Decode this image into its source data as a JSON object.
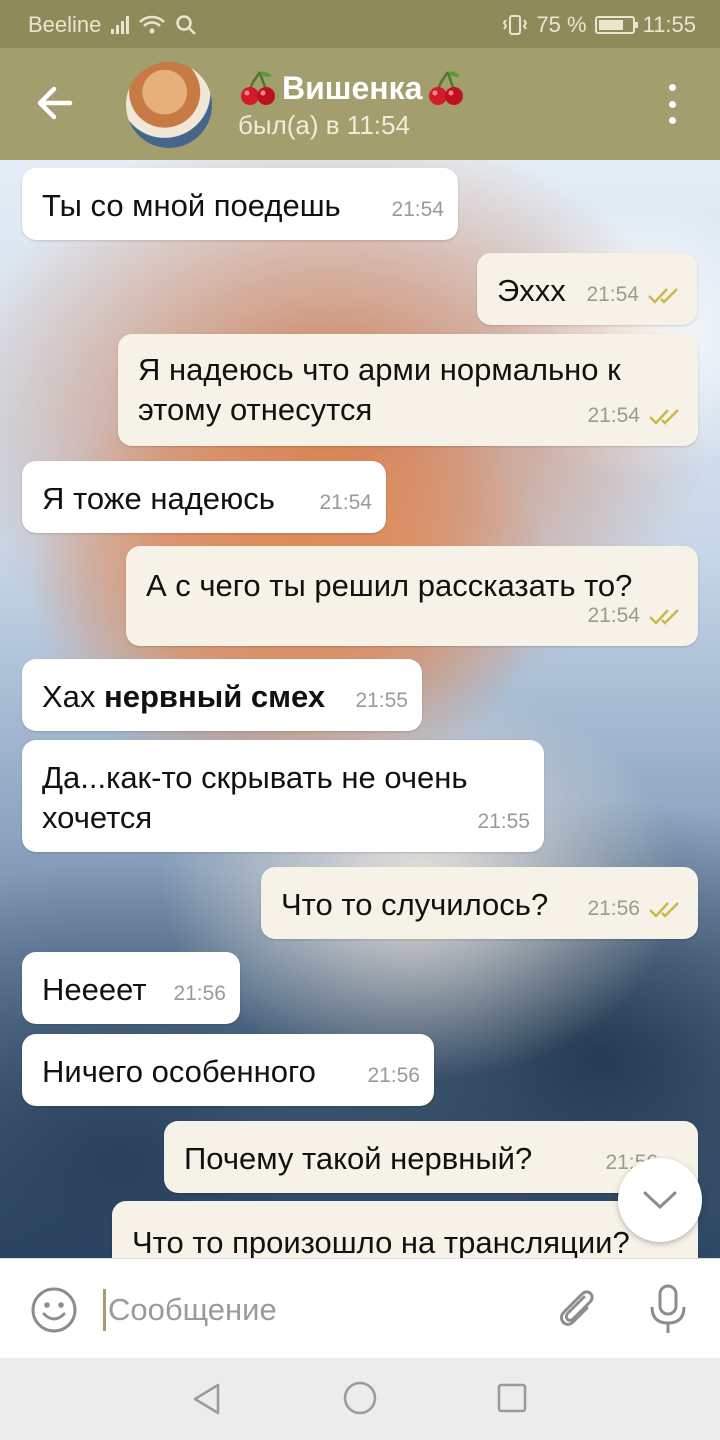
{
  "status_bar": {
    "carrier": "Beeline",
    "battery": "75 %",
    "battery_level": 0.75,
    "time": "11:55"
  },
  "header": {
    "contact_name": "Вишенка",
    "last_seen": "был(а) в 11:54"
  },
  "messages": [
    {
      "dir": "in",
      "text": "Ты со мной поедешь",
      "time": "21:54"
    },
    {
      "dir": "out",
      "text": "Эххх",
      "time": "21:54",
      "read": true
    },
    {
      "dir": "out",
      "text": "Я надеюсь что арми нормально к этому отнесутся",
      "time": "21:54",
      "read": true
    },
    {
      "dir": "in",
      "text": "Я тоже надеюсь",
      "time": "21:54"
    },
    {
      "dir": "out",
      "text": "А с чего ты решил рассказать то?",
      "time": "21:54",
      "read": true
    },
    {
      "dir": "in",
      "text_prefix": "Хах ",
      "text_bold": "нервный смех",
      "time": "21:55"
    },
    {
      "dir": "in",
      "text": "Да...как-то скрывать не очень хочется",
      "time": "21:55"
    },
    {
      "dir": "out",
      "text": "Что то случилось?",
      "time": "21:56",
      "read": true
    },
    {
      "dir": "in",
      "text": "Неееет",
      "time": "21:56"
    },
    {
      "dir": "in",
      "text": "Ничего особенного",
      "time": "21:56"
    },
    {
      "dir": "out",
      "text": "Почему такой нервный?",
      "time": "21:56"
    },
    {
      "dir": "out",
      "text": "Что то произошло на трансляции?"
    }
  ],
  "input": {
    "placeholder": "Сообщение"
  },
  "colors": {
    "header": "#a29e6d",
    "status_bar": "#8f8a5a",
    "outgoing_bubble": "#f6f2e7",
    "incoming_bubble": "#ffffff",
    "read_ticks": "#c9b94d"
  }
}
